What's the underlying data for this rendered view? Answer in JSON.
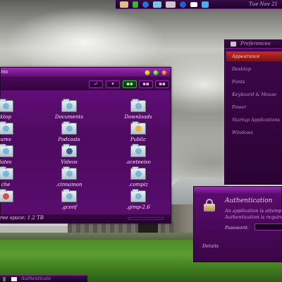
{
  "top_panel": {
    "tray_icons": [
      "folder-icon",
      "green-indicator-icon",
      "globe-icon",
      "network-icon",
      "battery-icon",
      "bluetooth-icon",
      "mail-icon",
      "volume-icon"
    ],
    "clock": "Tue Nov 21"
  },
  "file_manager": {
    "title": "ms",
    "items": [
      {
        "label": "ktop",
        "icon": "desktop-folder-icon"
      },
      {
        "label": "Documents",
        "icon": "documents-folder-icon"
      },
      {
        "label": "Downloads",
        "icon": "downloads-folder-icon"
      },
      {
        "label": "ures",
        "icon": "pictures-folder-icon"
      },
      {
        "label": "Podcasts",
        "icon": "podcasts-folder-icon"
      },
      {
        "label": "Public",
        "icon": "public-folder-icon"
      },
      {
        "label": "lates",
        "icon": "templates-folder-icon"
      },
      {
        "label": "Videos",
        "icon": "videos-folder-icon"
      },
      {
        "label": ".aceteeiso",
        "icon": "folder-icon"
      },
      {
        "label": "che",
        "icon": "cache-folder-icon"
      },
      {
        "label": ".cinnamon",
        "icon": "folder-icon"
      },
      {
        "label": ".compiz",
        "icon": "folder-icon"
      },
      {
        "label": "",
        "icon": "folder-icon"
      },
      {
        "label": ".gconf",
        "icon": "folder-icon"
      },
      {
        "label": ".gimp-2.6",
        "icon": "folder-icon"
      }
    ],
    "status": "ree space: 1.2 TB"
  },
  "settings": {
    "title": "Preferences",
    "items": [
      "Appearance",
      "Desktop",
      "Fonts",
      "Keyboard & Mouse",
      "Power",
      "Startup Applications",
      "Windows"
    ],
    "active_index": 0
  },
  "auth_dialog": {
    "heading": "Authentication",
    "line1": "An application is attempting",
    "line2": "Authentication is required",
    "password_label": "Password:",
    "details_label": "Details"
  },
  "taskbar": {
    "item_label": "Authenticate"
  }
}
